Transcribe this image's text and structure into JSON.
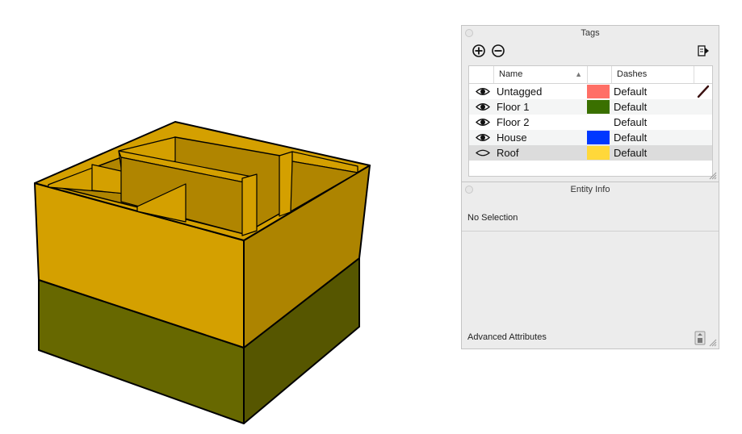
{
  "tags_panel": {
    "title": "Tags",
    "columns": {
      "name": "Name",
      "dashes": "Dashes"
    },
    "rows": [
      {
        "name": "Untagged",
        "visible": true,
        "color": "#ff6f66",
        "dashes": "Default",
        "selected": false
      },
      {
        "name": "Floor 1",
        "visible": true,
        "color": "#3a7000",
        "dashes": "Default",
        "selected": false
      },
      {
        "name": "Floor 2",
        "visible": true,
        "color": "",
        "dashes": "Default",
        "selected": false
      },
      {
        "name": "House",
        "visible": true,
        "color": "#0038ff",
        "dashes": "Default",
        "selected": false
      },
      {
        "name": "Roof",
        "visible": false,
        "color": "#ffd83a",
        "dashes": "Default",
        "selected": true
      }
    ]
  },
  "entity_panel": {
    "title": "Entity Info",
    "status": "No Selection",
    "advanced": "Advanced Attributes"
  },
  "model_colors": {
    "roof_top": "#d4a000",
    "roof_side": "#ad8400",
    "floor1_front": "#676800",
    "floor1_side": "#565600",
    "interior": "#b08500"
  }
}
